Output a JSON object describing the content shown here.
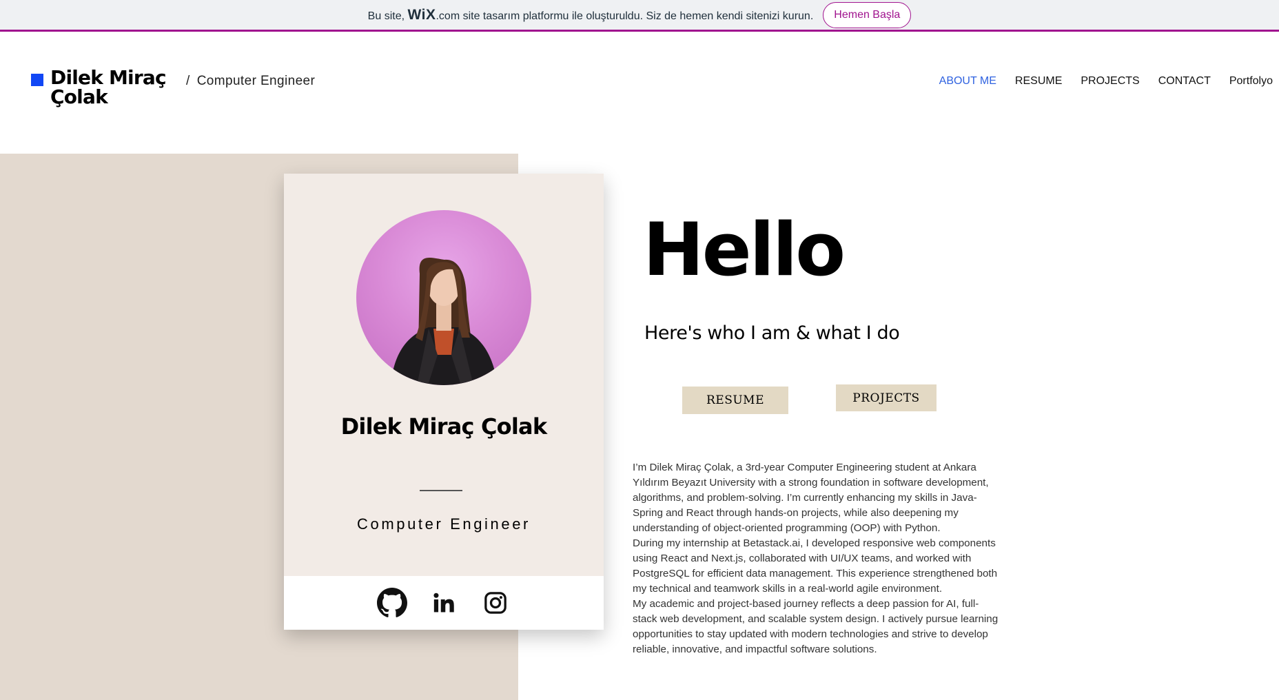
{
  "wix_banner": {
    "text_before": "Bu site,",
    "logo": "WiX",
    "text_after": ".com site tasarım platformu ile oluşturuldu. Siz de hemen kendi sitenizi kurun.",
    "cta_label": "Hemen Başla",
    "accent_color": "#a0138e"
  },
  "header": {
    "site_name": "Dilek Miraç Çolak",
    "tagline_slash": "/",
    "tagline": "Computer Engineer",
    "brand_color": "#1147f5",
    "nav": [
      {
        "label": "ABOUT ME",
        "active": true
      },
      {
        "label": "RESUME",
        "active": false
      },
      {
        "label": "PROJECTS",
        "active": false
      },
      {
        "label": "CONTACT",
        "active": false
      },
      {
        "label": "Portfolyo",
        "active": false
      }
    ],
    "nav_active_color": "#2f62e0"
  },
  "card": {
    "name": "Dilek Miraç Çolak",
    "title": "Computer Engineer",
    "social": [
      {
        "icon": "github-icon"
      },
      {
        "icon": "linkedin-icon"
      },
      {
        "icon": "instagram-icon"
      }
    ]
  },
  "hero": {
    "heading": "Hello",
    "subheading": "Here's who I am & what I do",
    "buttons": {
      "resume": "RESUME",
      "projects": "PROJECTS"
    }
  },
  "about": {
    "paragraphs": [
      "I’m Dilek Miraç Çolak, a 3rd-year Computer Engineering student at Ankara Yıldırım Beyazıt University with a strong foundation in software development, algorithms, and problem-solving. I’m currently enhancing my skills in Java-Spring and React through hands-on projects, while also deepening my understanding of object-oriented programming (OOP) with Python.",
      "During my internship at Betastack.ai, I developed responsive web components using React and Next.js, collaborated with UI/UX teams, and worked with PostgreSQL for efficient data management. This experience strengthened both my technical and teamwork skills in a real-world agile environment.",
      "My academic and project-based journey reflects a deep passion for AI, full-stack web development, and scalable system design. I actively pursue learning opportunities to stay updated with modern technologies and strive to develop reliable, innovative, and impactful software solutions."
    ]
  },
  "colors": {
    "beige_strip": "#e3d9cf",
    "card_background": "#f2ebe6",
    "button_background": "#e3d9c4"
  }
}
